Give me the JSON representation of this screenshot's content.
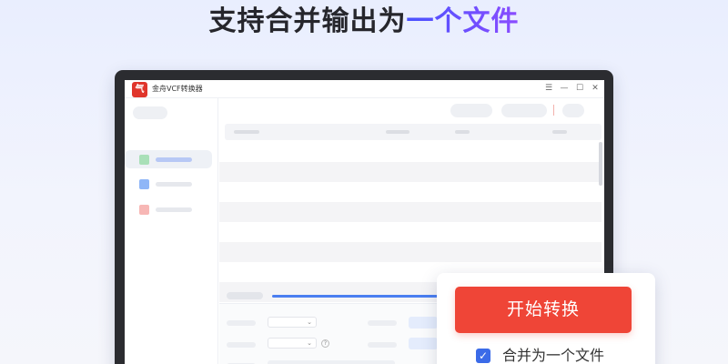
{
  "headline": {
    "prefix": "支持合并输出为",
    "highlight": "一个文件"
  },
  "window": {
    "logo_glyph": "气",
    "title": "金舟VCF转换器",
    "menu_glyph": "☰",
    "minimize_glyph": "—",
    "maximize_glyph": "☐",
    "close_glyph": "✕"
  },
  "sidebar": {
    "items": [
      {
        "icon_color": "#a9e0b8",
        "active": true
      },
      {
        "icon_color": "#8fb6f7",
        "active": false
      },
      {
        "icon_color": "#f7b7b5",
        "active": false
      }
    ]
  },
  "options": {
    "dropdown_glyph": "⌄",
    "help_glyph": "?"
  },
  "popup": {
    "start_label": "开始转换",
    "merge_label": "合并为一个文件",
    "merge_checked": true,
    "check_glyph": "✓"
  },
  "colors": {
    "accent_red": "#ef4537",
    "accent_blue": "#3b6be8",
    "headline_gradient_start": "#4a52ff",
    "headline_gradient_end": "#8b4cff"
  }
}
